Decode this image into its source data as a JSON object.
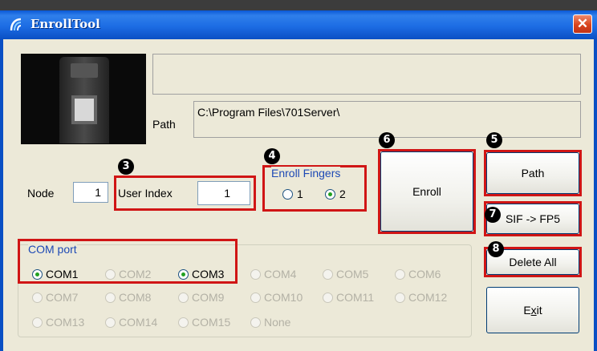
{
  "window": {
    "title": "EnrollTool",
    "close_glyph": "✕",
    "titlebar_color": "#0a58d6"
  },
  "path": {
    "label": "Path",
    "value": "C:\\Program Files\\701Server\\"
  },
  "node": {
    "label": "Node",
    "value": "1"
  },
  "user_index": {
    "label": "User Index",
    "value": "1"
  },
  "enroll_fingers": {
    "label": "Enroll Fingers",
    "options": [
      {
        "label": "1",
        "checked": false
      },
      {
        "label": "2",
        "checked": true
      }
    ]
  },
  "buttons": {
    "enroll": "Enroll",
    "path": "Path",
    "sif_fp5": "SIF -> FP5",
    "delete_all": "Delete All",
    "exit_pre": "E",
    "exit_mnemonic": "x",
    "exit_post": "it"
  },
  "com_port": {
    "label": "COM port",
    "options": [
      {
        "label": "COM1",
        "checked": true,
        "enabled": true
      },
      {
        "label": "COM2",
        "checked": false,
        "enabled": false
      },
      {
        "label": "COM3",
        "checked": true,
        "enabled": true
      },
      {
        "label": "COM4",
        "checked": false,
        "enabled": false
      },
      {
        "label": "COM5",
        "checked": false,
        "enabled": false
      },
      {
        "label": "COM6",
        "checked": false,
        "enabled": false
      },
      {
        "label": "COM7",
        "checked": false,
        "enabled": false
      },
      {
        "label": "COM8",
        "checked": false,
        "enabled": false
      },
      {
        "label": "COM9",
        "checked": false,
        "enabled": false
      },
      {
        "label": "COM10",
        "checked": false,
        "enabled": false
      },
      {
        "label": "COM11",
        "checked": false,
        "enabled": false
      },
      {
        "label": "COM12",
        "checked": false,
        "enabled": false
      },
      {
        "label": "COM13",
        "checked": false,
        "enabled": false
      },
      {
        "label": "COM14",
        "checked": false,
        "enabled": false
      },
      {
        "label": "COM15",
        "checked": false,
        "enabled": false
      },
      {
        "label": "None",
        "checked": false,
        "enabled": false
      }
    ]
  },
  "callouts": [
    "3",
    "4",
    "5",
    "6",
    "7",
    "8"
  ],
  "colors": {
    "callout_box": "#d01515",
    "group_label": "#1d49b5"
  },
  "icons": {
    "app": "fingerprint-app-icon",
    "device": "fingerprint-reader-photo"
  }
}
